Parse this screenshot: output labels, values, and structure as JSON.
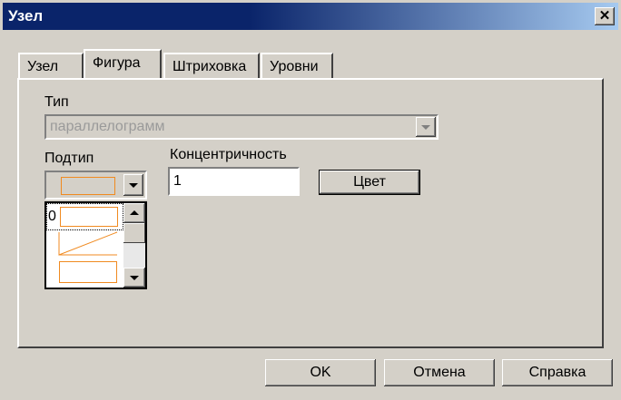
{
  "window": {
    "title": "Узел",
    "close_glyph": "✕"
  },
  "tabs": [
    {
      "label": "Узел",
      "active": false
    },
    {
      "label": "Фигура",
      "active": true
    },
    {
      "label": "Штриховка",
      "active": false
    },
    {
      "label": "Уровни",
      "active": false
    }
  ],
  "form": {
    "type_label": "Тип",
    "type_value": "параллелограмм",
    "subtype_label": "Подтип",
    "subtype_list_index": "0",
    "concentricity_label": "Концентричность",
    "concentricity_value": "1",
    "color_button": "Цвет"
  },
  "buttons": {
    "ok": "OK",
    "cancel": "Отмена",
    "help": "Справка"
  },
  "colors": {
    "shape_stroke": "#f08a20",
    "titlebar": "#0a246a"
  },
  "icons": {
    "close": "close-icon",
    "dropdown": "chevron-down-icon",
    "scroll_up": "arrow-up-icon",
    "scroll_down": "arrow-down-icon"
  }
}
